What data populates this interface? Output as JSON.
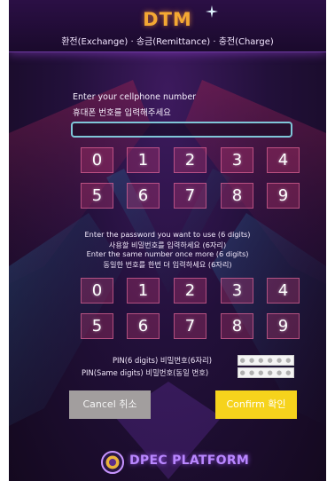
{
  "header": {
    "title": "DTM",
    "subtitle": "환전(Exchange) · 송금(Remittance) · 충전(Charge)"
  },
  "phone": {
    "label_en": "Enter your cellphone number",
    "label_ko": "휴대폰 번호를 입력해주세요",
    "value": ""
  },
  "keypad1": [
    "0",
    "1",
    "2",
    "3",
    "4",
    "5",
    "6",
    "7",
    "8",
    "9"
  ],
  "password_instructions": {
    "line1": "Enter the password you want to use (6 digits)",
    "line2": "사용할 비밀번호를 입력하세요 (6자리)",
    "line3": "Enter the same number once more (6 digits)",
    "line4": "동일한 번호를 한번 더 입력하세요 (6자리)"
  },
  "keypad2": [
    "0",
    "1",
    "2",
    "3",
    "4",
    "5",
    "6",
    "7",
    "8",
    "9"
  ],
  "pin": {
    "label": "PIN(6 digits) 비밀번호(6자리)",
    "value": "● ● ● ● ● ●",
    "confirm_label": "PIN(Same digits) 비밀번호(동일 번호)",
    "confirm_value": "● ● ● ● ● ●"
  },
  "buttons": {
    "cancel": "Cancel 취소",
    "confirm": "Confirm 확인"
  },
  "footer": {
    "brand": "DPEC PLATFORM"
  },
  "colors": {
    "accent_title": "#f4a833",
    "key_fill": "#d23c78",
    "confirm": "#f6d31c",
    "cancel": "#a29e9e",
    "brand_purple": "#b987ff"
  }
}
